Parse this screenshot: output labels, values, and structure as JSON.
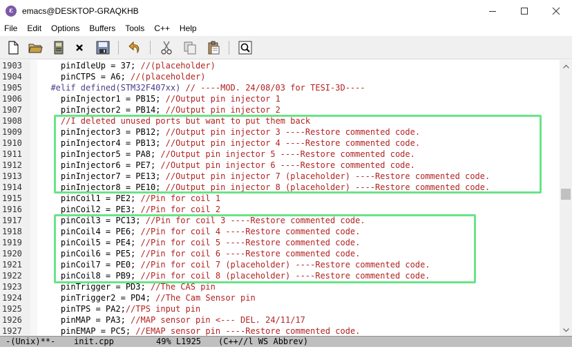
{
  "window": {
    "title": "emacs@DESKTOP-GRAQKHB",
    "app_icon_glyph": "ε"
  },
  "menu": [
    "File",
    "Edit",
    "Options",
    "Buffers",
    "Tools",
    "C++",
    "Help"
  ],
  "toolbar": {
    "icons": [
      "new-file-icon",
      "open-folder-icon",
      "save-file-icon",
      "close-buffer-icon",
      "save-as-icon",
      "undo-icon",
      "cut-icon",
      "copy-icon",
      "paste-icon",
      "search-icon"
    ]
  },
  "editor": {
    "lines": [
      {
        "num": "1903",
        "code": "    pinIdleUp = 37; ",
        "comment": "//(placeholder)"
      },
      {
        "num": "1904",
        "code": "    pinCTPS = A6; ",
        "comment": "//(placeholder)"
      },
      {
        "num": "1905",
        "code": "  #elif defined(STM32F407xx) ",
        "comment": "// ----MOD. 24/08/03 for TESI-3D----"
      },
      {
        "num": "1906",
        "code": "    pinInjector1 = PB15; ",
        "comment": "//Output pin injector 1"
      },
      {
        "num": "1907",
        "code": "    pinInjector2 = PB14; ",
        "comment": "//Output pin injector 2"
      },
      {
        "num": "1908",
        "code": "    ",
        "comment": "//I deleted unused ports but want to put them back"
      },
      {
        "num": "1909",
        "code": "    pinInjector3 = PB12; ",
        "comment": "//Output pin injector 3 ----Restore commented code."
      },
      {
        "num": "1910",
        "code": "    pinInjector4 = PB13; ",
        "comment": "//Output pin injector 4 ----Restore commented code."
      },
      {
        "num": "1911",
        "code": "    pinInjector5 = PA8; ",
        "comment": "//Output pin injector 5 ----Restore commented code."
      },
      {
        "num": "1912",
        "code": "    pinInjector6 = PE7; ",
        "comment": "//Output pin injector 6 ----Restore commented code."
      },
      {
        "num": "1913",
        "code": "    pinInjector7 = PE13; ",
        "comment": "//Output pin injector 7 (placeholder) ----Restore commented code."
      },
      {
        "num": "1914",
        "code": "    pinInjector8 = PE10; ",
        "comment": "//Output pin injector 8 (placeholder) ----Restore commented code."
      },
      {
        "num": "1915",
        "code": "    pinCoil1 = PE2; ",
        "comment": "//Pin for coil 1"
      },
      {
        "num": "1916",
        "code": "    pinCoil2 = PE3; ",
        "comment": "//Pin for coil 2"
      },
      {
        "num": "1917",
        "code": "    pinCoil3 = PC13; ",
        "comment": "//Pin for coil 3 ----Restore commented code."
      },
      {
        "num": "1918",
        "code": "    pinCoil4 = PE6; ",
        "comment": "//Pin for coil 4 ----Restore commented code."
      },
      {
        "num": "1919",
        "code": "    pinCoil5 = PE4; ",
        "comment": "//Pin for coil 5 ----Restore commented code."
      },
      {
        "num": "1920",
        "code": "    pinCoil6 = PE5; ",
        "comment": "//Pin for coil 6 ----Restore commented code."
      },
      {
        "num": "1921",
        "code": "    pinCoil7 = PE0; ",
        "comment": "//Pin for coil 7 (placeholder) ----Restore commented code."
      },
      {
        "num": "1922",
        "code": "    pinCoil8 = PB9; ",
        "comment": "//Pin for coil 8 (placeholder) ----Restore commented code."
      },
      {
        "num": "1923",
        "code": "    pinTrigger = PD3; ",
        "comment": "//The CAS pin"
      },
      {
        "num": "1924",
        "code": "    pinTrigger2 = PD4; ",
        "comment": "//The Cam Sensor pin"
      },
      {
        "num": "1925",
        "code": "    pinTPS = PA2;",
        "comment": "//TPS input pin"
      },
      {
        "num": "1926",
        "code": "    pinMAP = PA3; ",
        "comment": "//MAP sensor pin <--- DEL. 24/11/17"
      },
      {
        "num": "1927",
        "code": "    pinEMAP = PC5; ",
        "comment": "//EMAP sensor pin ----Restore commented code."
      }
    ]
  },
  "modeline": {
    "state": "-(Unix)**-",
    "buffer": "init.cpp",
    "position": "49% L1925",
    "mode": "(C++//l WS Abbrev)"
  },
  "colors": {
    "comment": "#b22222",
    "preprocessor": "#483d8b",
    "highlight_box": "#69e388",
    "modeline_bg": "#bfbfbf"
  }
}
